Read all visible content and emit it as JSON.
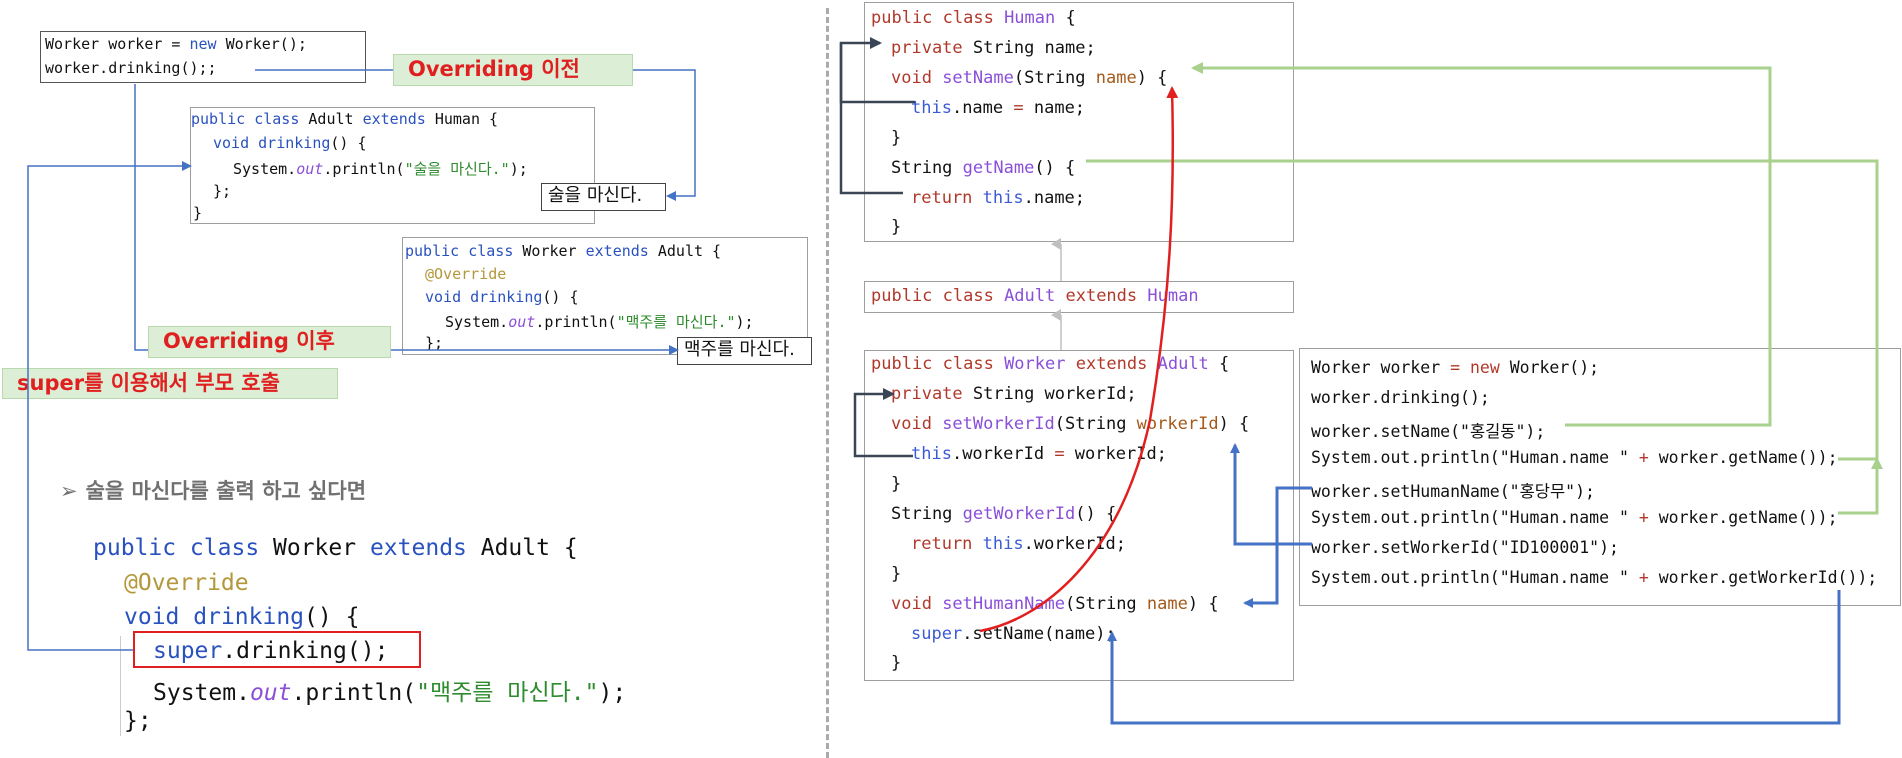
{
  "left": {
    "caller": {
      "lines": [
        "Worker worker = new Worker();",
        "worker.drinking();;"
      ]
    },
    "labels": {
      "before": "Overriding 이전",
      "after": "Overriding 이후",
      "super_call": "super를 이용해서 부모 호출"
    },
    "adult_class": {
      "line1_a": "public class ",
      "line1_b": "Adult ",
      "line1_c": "extends ",
      "line1_d": "Human {",
      "line2_a": "void ",
      "line2_b": "drinking",
      "line2_c": "() {",
      "line3_a": "System.",
      "line3_b": "out",
      "line3_c": ".println(",
      "line3_d": "\"술을 마신다.\"",
      "line3_e": ");",
      "line4": "};",
      "line5": "}"
    },
    "adult_output": "술을 마신다.",
    "worker_class": {
      "line1_a": "public class ",
      "line1_b": "Worker ",
      "line1_c": "extends ",
      "line1_d": "Adult {",
      "line2": "@Override",
      "line3_a": "void ",
      "line3_b": "drinking",
      "line3_c": "() {",
      "line4_a": "System.",
      "line4_b": "out",
      "line4_c": ".println(",
      "line4_d": "\"맥주를 마신다.\"",
      "line4_e": ");",
      "line5": "};"
    },
    "worker_output": "맥주를 마신다.",
    "bullet_symbol": "➢",
    "bullet_text": "술을 마신다를 출력 하고 싶다면",
    "big_code": {
      "line1_a": "public class ",
      "line1_b": "Worker ",
      "line1_c": "extends ",
      "line1_d": "Adult {",
      "line2": "@Override",
      "line3_a": "void ",
      "line3_b": "drinking",
      "line3_c": "() {",
      "line4_a": "super",
      "line4_b": ".drinking();",
      "line5_a": "System.",
      "line5_b": "out",
      "line5_c": ".println(",
      "line5_d": "\"맥주를 마신다.\"",
      "line5_e": ");",
      "line6": "};"
    }
  },
  "right": {
    "human_class": {
      "l1_a": "public class ",
      "l1_b": "Human",
      "l1_c": " {",
      "l2_a": "private ",
      "l2_b": "String name;",
      "l3_a": "void ",
      "l3_b": "setName",
      "l3_c": "(String ",
      "l3_d": "name",
      "l3_e": ") {",
      "l4_a": "this",
      "l4_b": ".name ",
      "l4_c": "=",
      "l4_d": " name;",
      "l5": "}",
      "l6_a": "String ",
      "l6_b": "getName",
      "l6_c": "() {",
      "l7_a": "return ",
      "l7_b": "this",
      "l7_c": ".name;",
      "l8": "}"
    },
    "adult_class": {
      "a": "public class ",
      "b": "Adult ",
      "c": "extends ",
      "d": "Human"
    },
    "worker_class": {
      "l1_a": "public class ",
      "l1_b": "Worker ",
      "l1_c": "extends ",
      "l1_d": "Adult",
      "l1_e": " {",
      "l2_a": "private ",
      "l2_b": "String workerId;",
      "l3_a": "void ",
      "l3_b": "setWorkerId",
      "l3_c": "(String ",
      "l3_d": "workerId",
      "l3_e": ") {",
      "l4_a": "this",
      "l4_b": ".workerId ",
      "l4_c": "=",
      "l4_d": " workerId;",
      "l5": "}",
      "l6_a": "String ",
      "l6_b": "getWorkerId",
      "l6_c": "() {",
      "l7_a": "return ",
      "l7_b": "this",
      "l7_c": ".workerId;",
      "l8": "}",
      "l9_a": "void ",
      "l9_b": "setHumanName",
      "l9_c": "(String ",
      "l9_d": "name",
      "l9_e": ") {",
      "l10_a": "super",
      "l10_b": ".setName(name);",
      "l11": "}"
    },
    "main_code": {
      "l1_a": "Worker worker ",
      "l1_b": "=",
      "l1_c": " ",
      "l1_d": "new",
      "l1_e": " Worker();",
      "l2": "worker.drinking();",
      "l3": "worker.setName(\"홍길동\");",
      "l4_a": "System.out.println(\"Human.name \" ",
      "l4_b": "+",
      "l4_c": " worker.getName());",
      "l5": "worker.setHumanName(\"홍당무\");",
      "l6_a": "System.out.println(\"Human.name \" ",
      "l6_b": "+",
      "l6_c": " worker.getName());",
      "l7": "worker.setWorkerId(\"ID100001\");",
      "l8_a": "System.out.println(\"Human.name \" ",
      "l8_b": "+",
      "l8_c": " worker.getWorkerId());"
    }
  },
  "colors": {
    "keyword": "#2a52be",
    "class_name": "#8a4fd8",
    "string": "#2e8b2e",
    "annotation": "#b3973a",
    "label_text": "#e02020",
    "label_bg": "#dcefd6",
    "arrow_blue": "#4472c4",
    "arrow_green": "#a9d18e",
    "arrow_red": "#e02020",
    "arrow_dark": "#3a4656"
  }
}
